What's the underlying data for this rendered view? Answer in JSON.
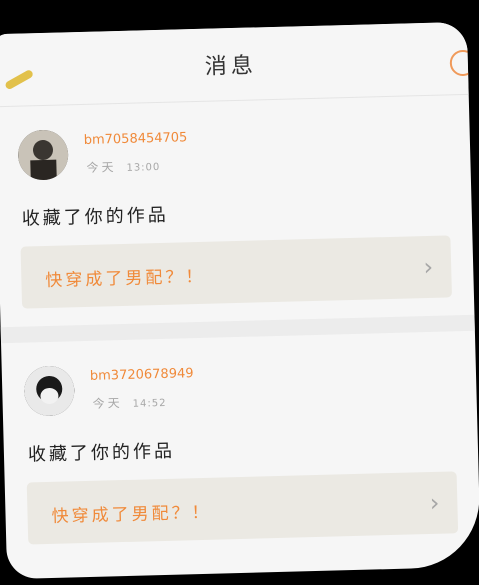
{
  "header": {
    "title": "消息"
  },
  "messages": [
    {
      "username": "bm7058454705",
      "day": "今天",
      "time": "13:00",
      "text": "收藏了你的作品",
      "work_title": "快穿成了男配？！"
    },
    {
      "username": "bm3720678949",
      "day": "今天",
      "time": "14:52",
      "text": "收藏了你的作品",
      "work_title": "快穿成了男配？！"
    }
  ],
  "icons": [
    "chevron-right-icon"
  ],
  "colors": {
    "accent": "#f08a3a",
    "card_bg": "#f6f6f6",
    "work_box_bg": "#ebe9e3"
  }
}
